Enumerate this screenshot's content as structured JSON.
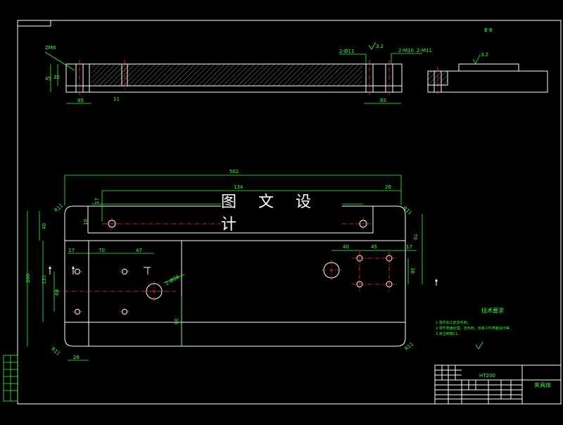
{
  "watermark": "图 文 设 计",
  "section_label": "B-B",
  "top_view": {
    "zm_label": "ZM8",
    "dim_45": "45",
    "dim_35": "35",
    "dim_85": "85",
    "dim_11": "11",
    "holes_callout_left": "2-Ø11",
    "holes_callout_mid": "2-M10",
    "holes_callout_right": "2-M11",
    "dim_65": "65",
    "finish_a": "3.2",
    "finish_b": "3.2"
  },
  "plan_view": {
    "dim_overall": "502",
    "dim_inner": "134",
    "dim_28_top": "28",
    "dim_17_left": "17",
    "dim_10": "10",
    "dim_40_left": "40",
    "dim_200": "200",
    "dim_131": "131",
    "dim_68": "68",
    "dim_17_b": "17",
    "dim_70": "70",
    "dim_47": "47",
    "dim_40_right": "40",
    "dim_45_right": "45",
    "dim_17_right": "17",
    "dim_70_right": "70",
    "dim_38": "38",
    "dim_30_mid": "30",
    "dim_28_bottom": "28",
    "radius_tl": "R11",
    "radius_tr": "R11",
    "radius_bl": "R11",
    "radius_br": "R11",
    "hole_callout": "2-Ø28"
  },
  "tech_req": {
    "title": "技术要求",
    "lines": [
      "1.零件加工前去毛刺。",
      "2.零件表面处理，去毛刺，去除工件表面油污等。",
      "3.未注倒角C1。"
    ]
  },
  "title_block": {
    "drawing_name": "夹具体",
    "material": "HT200"
  }
}
